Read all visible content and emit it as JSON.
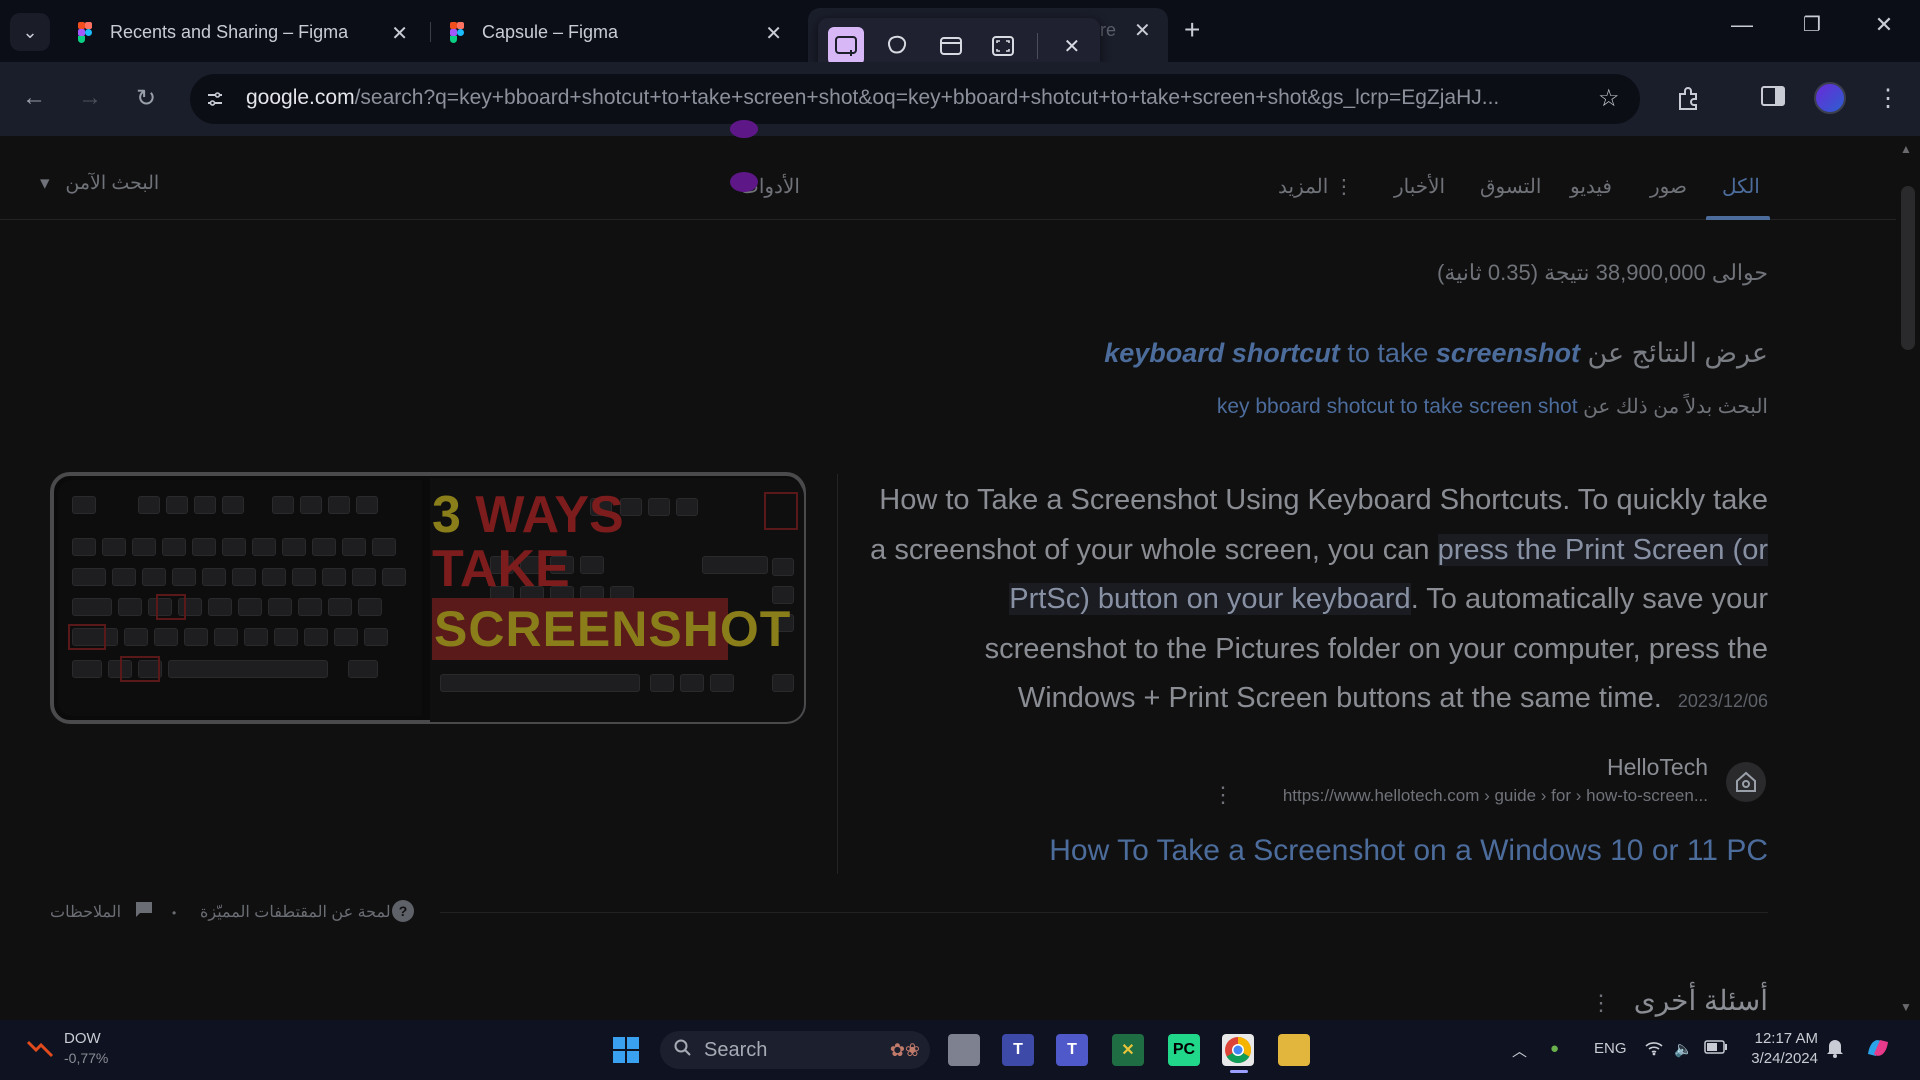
{
  "browser": {
    "tabs": [
      {
        "title": "Recents and Sharing – Figma"
      },
      {
        "title": "Capsule – Figma"
      },
      {
        "title": "re"
      }
    ],
    "url_host": "google.com",
    "url_path": "/search?q=key+bboard+shotcut+to+take+screen+shot&oq=key+bboard+shotcut+to+take+screen+shot&gs_lcrp=EgZjaHJ..."
  },
  "snip_toolbar": {
    "modes": [
      "rectangle-snip",
      "freeform-snip",
      "window-snip",
      "fullscreen-snip"
    ]
  },
  "search_tabs": {
    "all": "الكل",
    "images": "صور",
    "videos": "فيديو",
    "shopping": "التسوق",
    "news": "الأخبار",
    "more": "المزيد",
    "tools": "الأدوات",
    "safe_search": "البحث الآمن"
  },
  "results": {
    "stats": "حوالى 38,900,000 نتيجة (0.35 ثانية)",
    "showing_for_prefix": "عرض النتائج عن",
    "corrected_query_bold1": "keyboard shortcut",
    "corrected_query_mid": "to take",
    "corrected_query_bold2": "screenshot",
    "search_instead_prefix": "البحث بدلاً من ذلك عن",
    "original_query": "key bboard shotcut to take screen shot"
  },
  "featured_snippet": {
    "text_part1": "How to Take a Screenshot Using Keyboard Shortcuts. To quickly take a screenshot of your whole screen, you can",
    "highlight": "press the Print Screen (or PrtSc) button on your keyboard",
    "text_part2": ". To automatically save your screenshot to the Pictures folder on your computer, press the Windows + Print Screen buttons at the same time.",
    "date": "2023/12/06",
    "image_text_line1_num": "3",
    "image_text_line1": "WAYS",
    "image_text_line2": "TAKE",
    "image_text_line3": "SCREENSHOT",
    "source_name": "HelloTech",
    "source_url": "https://www.hellotech.com › guide › for › how-to-screen...",
    "result_title": "How To Take a Screenshot on a Windows 10 or 11 PC",
    "about_featured": "لمحة عن المقتطفات المميّزة",
    "feedback": "الملاحظات"
  },
  "other_questions": "أسئلة أخرى",
  "taskbar": {
    "weather_label": "DOW",
    "weather_value": "-0,77%",
    "search_placeholder": "Search",
    "lang": "ENG",
    "time": "12:17 AM",
    "date": "3/24/2024"
  },
  "colors": {
    "accent_link": "#4c6c9c",
    "snip_active": "#d8b7f7",
    "blob": "#5e1787"
  }
}
